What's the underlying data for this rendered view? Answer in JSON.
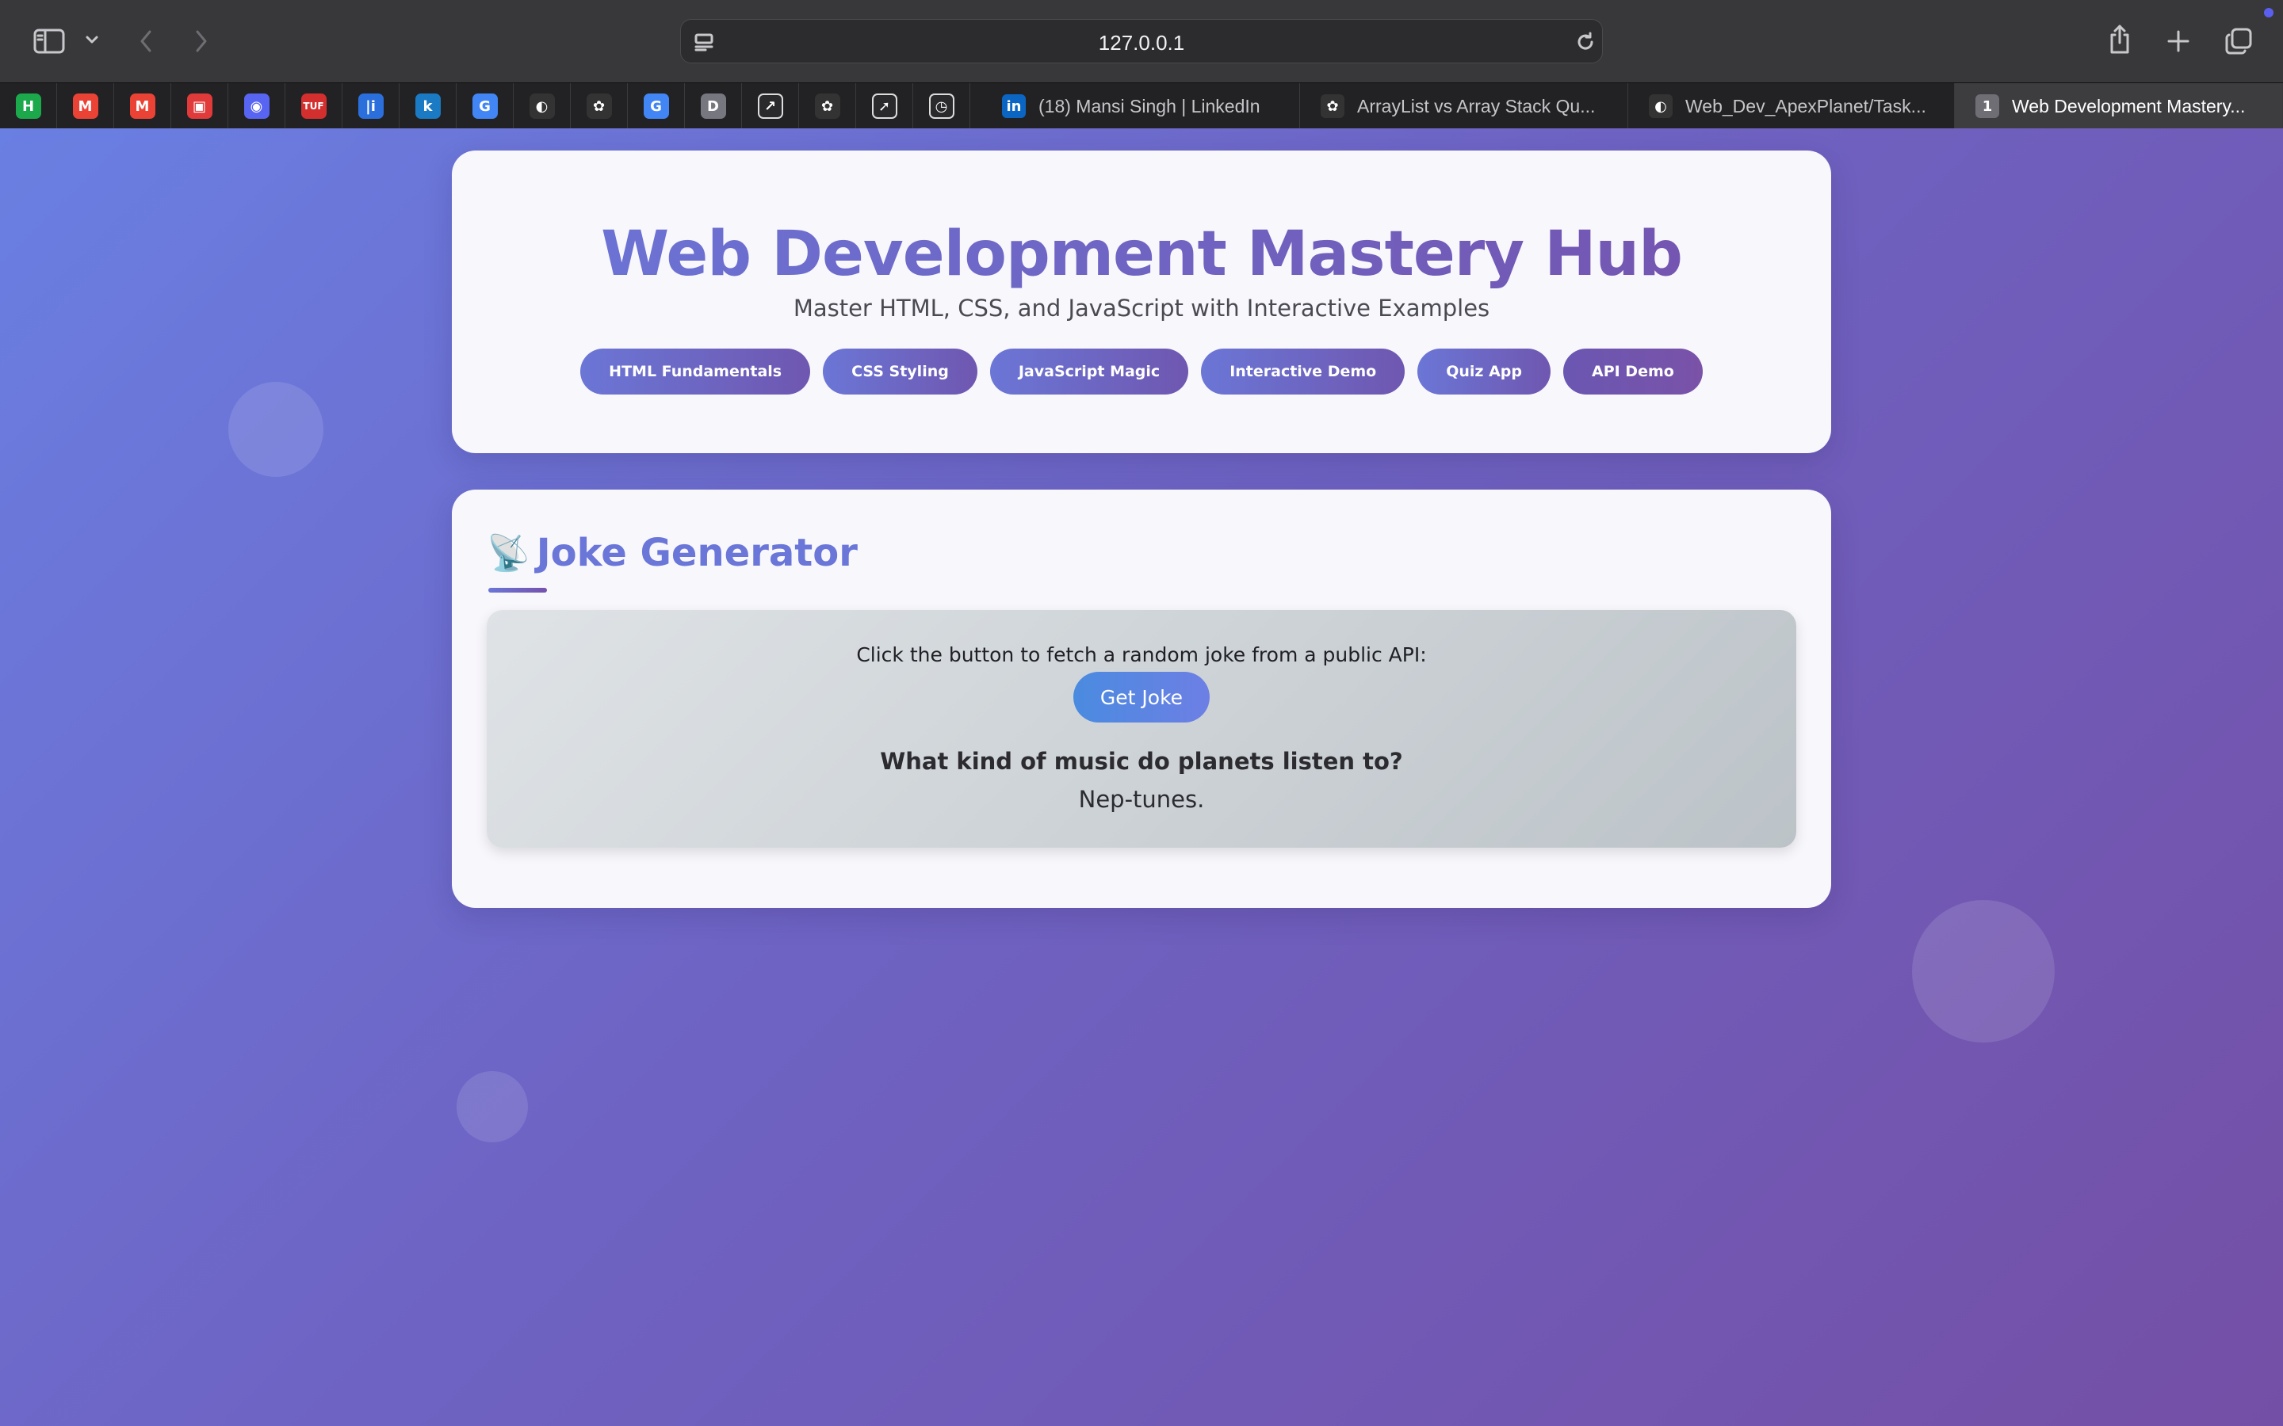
{
  "browser": {
    "url": "127.0.0.1",
    "favorites": [
      {
        "icon": "hackerrank-icon",
        "glyph": "H",
        "color": "#1ba94c"
      },
      {
        "icon": "gmail-icon",
        "glyph": "M",
        "color": "#ea4335"
      },
      {
        "icon": "gmail-icon",
        "glyph": "M",
        "color": "#ea4335"
      },
      {
        "icon": "box-icon",
        "glyph": "▣",
        "color": "#e03a3a"
      },
      {
        "icon": "discord-icon",
        "glyph": "◉",
        "color": "#5865f2"
      },
      {
        "icon": "tuf-icon",
        "glyph": "TUF",
        "color": "#d32f2f"
      },
      {
        "icon": "stats-icon",
        "glyph": "|i",
        "color": "#2a6fdb"
      },
      {
        "icon": "k-icon",
        "glyph": "k",
        "color": "#1a7ac4"
      },
      {
        "icon": "google-icon",
        "glyph": "G",
        "color": "#4285f4"
      },
      {
        "icon": "github-icon",
        "glyph": "◐",
        "color": "#333333"
      },
      {
        "icon": "openai-icon",
        "glyph": "✿",
        "color": "#333333"
      },
      {
        "icon": "google-icon",
        "glyph": "G",
        "color": "#4285f4"
      },
      {
        "icon": "d-icon",
        "glyph": "D",
        "color": "#777780"
      },
      {
        "icon": "chart-icon",
        "glyph": "↗",
        "color": "#ffffff"
      },
      {
        "icon": "openai-icon",
        "glyph": "✿",
        "color": "#333333"
      },
      {
        "icon": "rocket-icon",
        "glyph": "➚",
        "color": "#ffffff"
      },
      {
        "icon": "clock-icon",
        "glyph": "◷",
        "color": "#ffffff"
      }
    ],
    "tabs": [
      {
        "label": "(18) Mansi Singh | LinkedIn",
        "icon": "linkedin-icon",
        "glyph": "in",
        "color": "#0a66c2"
      },
      {
        "label": "ArrayList vs Array Stack Qu...",
        "icon": "openai-icon",
        "glyph": "✿",
        "color": "#333333"
      },
      {
        "label": "Web_Dev_ApexPlanet/Task...",
        "icon": "github-icon",
        "glyph": "◐",
        "color": "#333333"
      },
      {
        "label": "Web Development Mastery...",
        "icon": "tab-count-icon",
        "glyph": "1",
        "color": "#6e6e74"
      }
    ]
  },
  "header": {
    "title": "Web Development Mastery Hub",
    "subtitle": "Master HTML, CSS, and JavaScript with Interactive Examples",
    "nav": [
      "HTML Fundamentals",
      "CSS Styling",
      "JavaScript Magic",
      "Interactive Demo",
      "Quiz App",
      "API Demo"
    ],
    "active_nav": "API Demo"
  },
  "joke_section": {
    "emoji": "📡",
    "title": "Joke Generator",
    "instruction": "Click the button to fetch a random joke from a public API:",
    "button_label": "Get Joke",
    "setup": "What kind of music do planets listen to?",
    "punchline": "Nep-tunes."
  }
}
